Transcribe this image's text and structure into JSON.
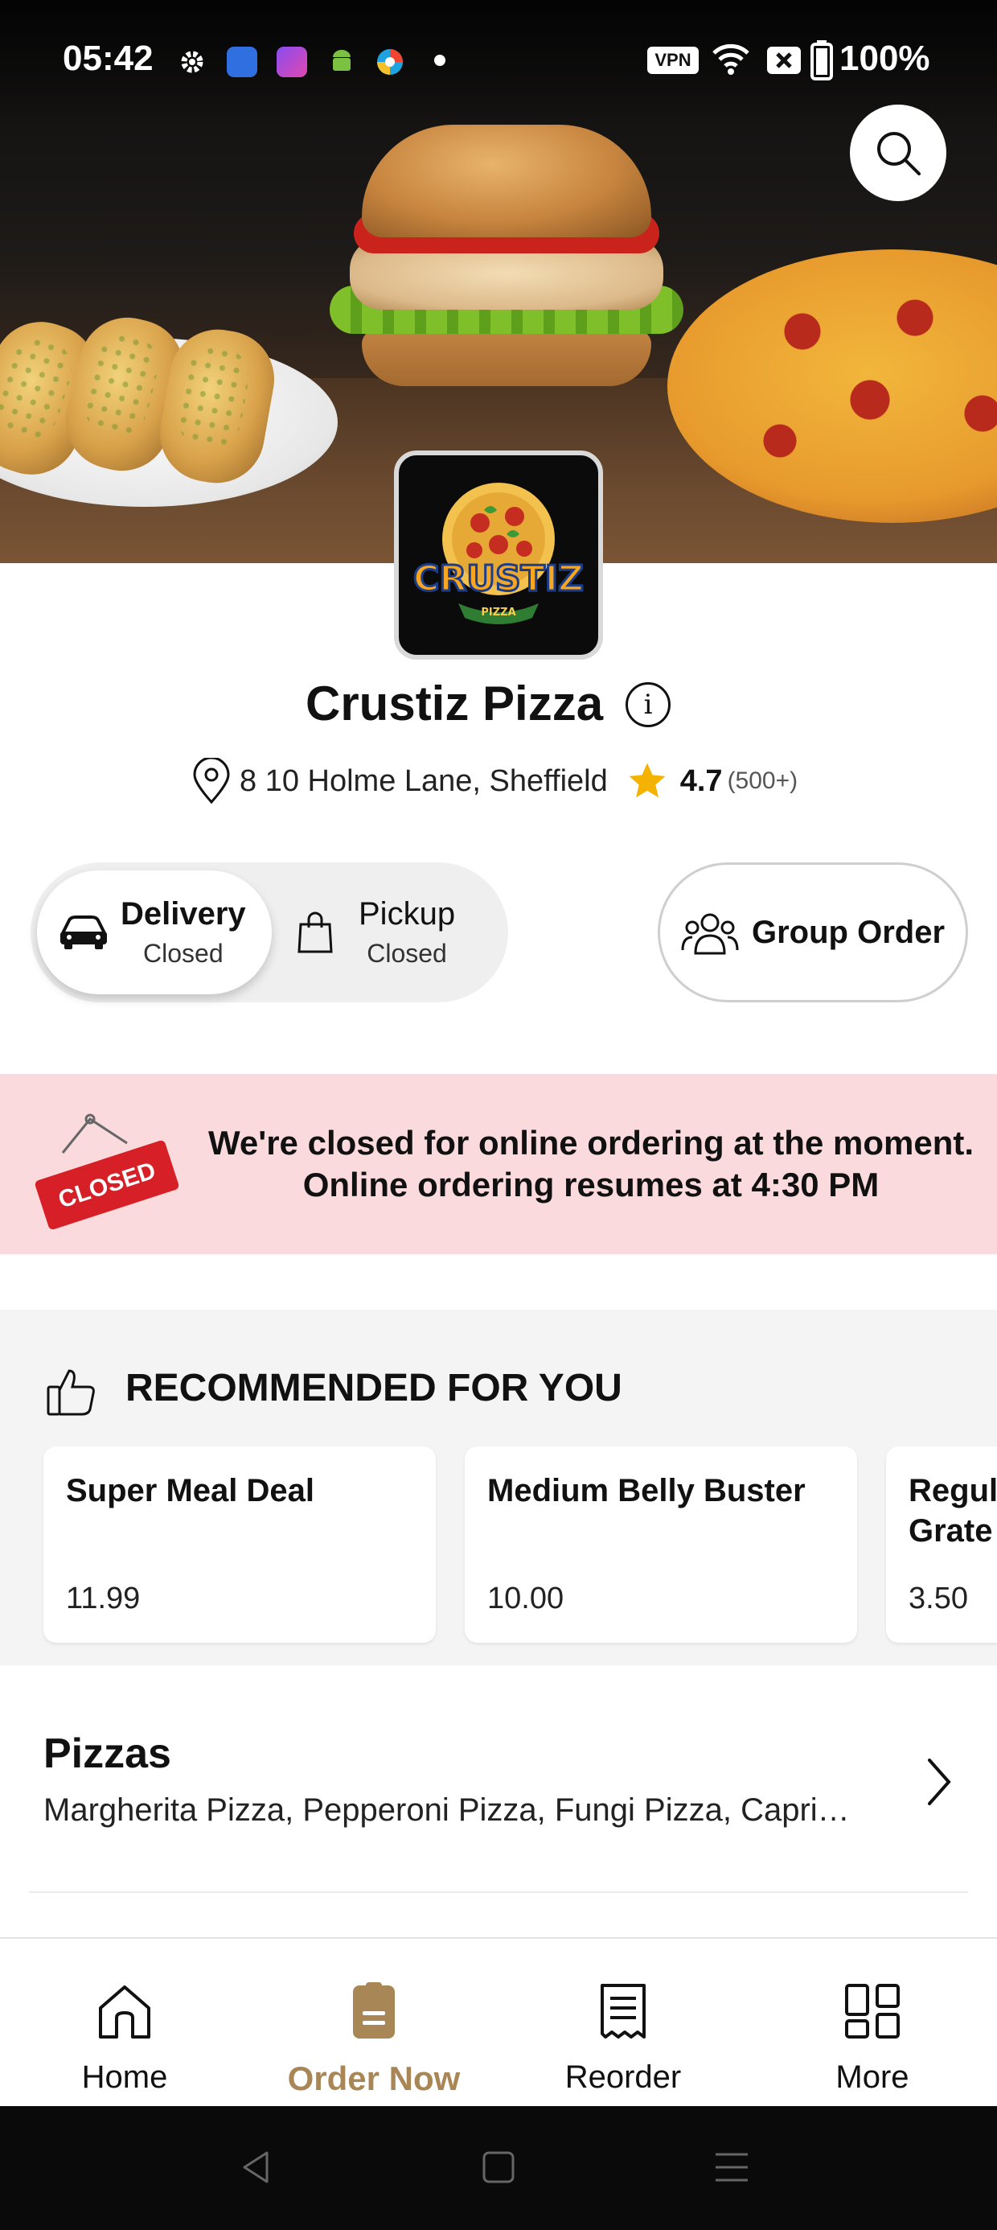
{
  "status_bar": {
    "time": "05:42",
    "vpn_label": "VPN",
    "battery": "100%"
  },
  "restaurant": {
    "name": "Crustiz Pizza",
    "logo_text": "CRUSTIZ",
    "logo_subtext": "PIZZA",
    "address": "8 10 Holme Lane, Sheffield",
    "rating": "4.7",
    "rating_count": "(500+)"
  },
  "order_modes": [
    {
      "label": "Delivery",
      "status": "Closed",
      "icon": "car-icon",
      "selected": true
    },
    {
      "label": "Pickup",
      "status": "Closed",
      "icon": "shopping-bag-icon",
      "selected": false
    }
  ],
  "group_order": {
    "label": "Group Order",
    "icon": "group-icon"
  },
  "closed_banner": {
    "sign_text": "CLOSED",
    "line1": "We're closed for online ordering at the moment.",
    "line2": "Online ordering resumes at 4:30 PM"
  },
  "recommended": {
    "title": "RECOMMENDED FOR YOU",
    "items": [
      {
        "name": "Super Meal Deal",
        "price": "11.99"
      },
      {
        "name": "Medium Belly Buster",
        "price": "10.00"
      },
      {
        "name": "Regul\nGrate",
        "price": "3.50"
      }
    ]
  },
  "category": {
    "title": "Pizzas",
    "description": "Margherita Pizza, Pepperoni Pizza, Fungi Pizza, Capri…"
  },
  "bottom_nav": [
    {
      "label": "Home",
      "icon": "home-icon",
      "active": false
    },
    {
      "label": "Order Now",
      "icon": "order-icon",
      "active": true
    },
    {
      "label": "Reorder",
      "icon": "receipt-icon",
      "active": false
    },
    {
      "label": "More",
      "icon": "grid-icon",
      "active": false
    }
  ],
  "colors": {
    "accent": "#a98656",
    "closed_banner_bg": "#fadadd",
    "closed_sign": "#d61f26",
    "star": "#f5b301"
  }
}
